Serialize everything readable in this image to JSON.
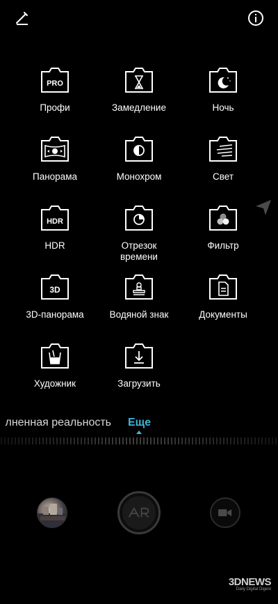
{
  "modes": [
    {
      "label": "Профи",
      "icon": "pro-icon",
      "glyph": "PRO"
    },
    {
      "label": "Замедление",
      "icon": "hourglass-icon"
    },
    {
      "label": "Ночь",
      "icon": "night-moon-icon"
    },
    {
      "label": "Панорама",
      "icon": "panorama-icon"
    },
    {
      "label": "Монохром",
      "icon": "monochrome-icon"
    },
    {
      "label": "Свет",
      "icon": "light-trails-icon"
    },
    {
      "label": "HDR",
      "icon": "hdr-icon",
      "glyph": "HDR"
    },
    {
      "label": "Отрезок\nвремени",
      "icon": "timelapse-icon"
    },
    {
      "label": "Фильтр",
      "icon": "filter-icon"
    },
    {
      "label": "3D-панорама",
      "icon": "3d-panorama-icon",
      "glyph": "3D"
    },
    {
      "label": "Водяной знак",
      "icon": "watermark-stamp-icon"
    },
    {
      "label": "Документы",
      "icon": "document-icon"
    },
    {
      "label": "Художник",
      "icon": "artist-icon"
    },
    {
      "label": "Загрузить",
      "icon": "download-icon"
    }
  ],
  "tabs": {
    "previous": "лненная реальность",
    "active": "Еще"
  },
  "shutter": {
    "label": "AR"
  },
  "watermark": {
    "logo": "3DNEWS",
    "tagline": "Daily Digital Digest"
  },
  "colors": {
    "accent": "#3fb6d9",
    "background": "#000000"
  }
}
